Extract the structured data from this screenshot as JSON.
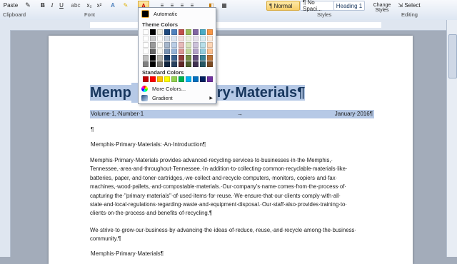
{
  "ribbon": {
    "paste_label": "Paste",
    "normal_style": "¶ Normal",
    "no_spacing_style": "¶ No Spaci...",
    "heading1_style": "Heading 1",
    "change_styles": "Change Styles",
    "select_label": "Select",
    "groups": {
      "clipboard": "Clipboard",
      "font": "Font",
      "styles": "Styles",
      "editing": "Editing"
    }
  },
  "palette": {
    "automatic": "Automatic",
    "theme_colors": "Theme Colors",
    "standard_colors": "Standard Colors",
    "more_colors": "More Colors...",
    "gradient": "Gradient",
    "theme_top": [
      "#ffffff",
      "#000000",
      "#eeece1",
      "#1f497d",
      "#4f81bd",
      "#c0504d",
      "#9bbb59",
      "#8064a2",
      "#4bacc6",
      "#f79646"
    ],
    "standard": [
      "#c00000",
      "#ff0000",
      "#ffc000",
      "#ffff00",
      "#92d050",
      "#00b050",
      "#00b0f0",
      "#0070c0",
      "#002060",
      "#7030a0"
    ]
  },
  "document": {
    "title_left": "Memp",
    "title_right": "ry·Materials¶",
    "volume": "Volume·1,·Number·1",
    "tab_mark": "→",
    "date": "January·2016¶",
    "pilcrow": "¶",
    "intro_heading": "Memphis·Primary·Materials:·An·Introduction¶",
    "para1_lines": [
      "Memphis·Primary·Materials·provides·advanced·recycling·services·to·businesses·in·the·Memphis,·",
      "Tennessee,·area·and·throughout·Tennessee.·In·addition·to·collecting·common·recyclable·materials·like·",
      "batteries,·paper,·and·toner·cartridges,·we·collect·and·recycle·computers,·monitors,·copiers·and·fax·",
      "machines,·wood·pallets,·and·compostable·materials.·Our·company's·name·comes·from·the·process·of·",
      "capturing·the·\"primary·materials\"·of·used·items·for·reuse.·We·ensure·that·our·clients·comply·with·all·",
      "state·and·local·regulations·regarding·waste·and·equipment·disposal.·Our·staff·also·provides·training·to·",
      "clients·on·the·process·and·benefits·of·recycling.¶"
    ],
    "para2_lines": [
      "We·strive·to·grow·our·business·by·advancing·the·ideas·of·reduce,·reuse,·and·recycle·among·the·business·",
      "community.¶"
    ],
    "footer_line": "Memphis·Primary·Materials¶"
  }
}
